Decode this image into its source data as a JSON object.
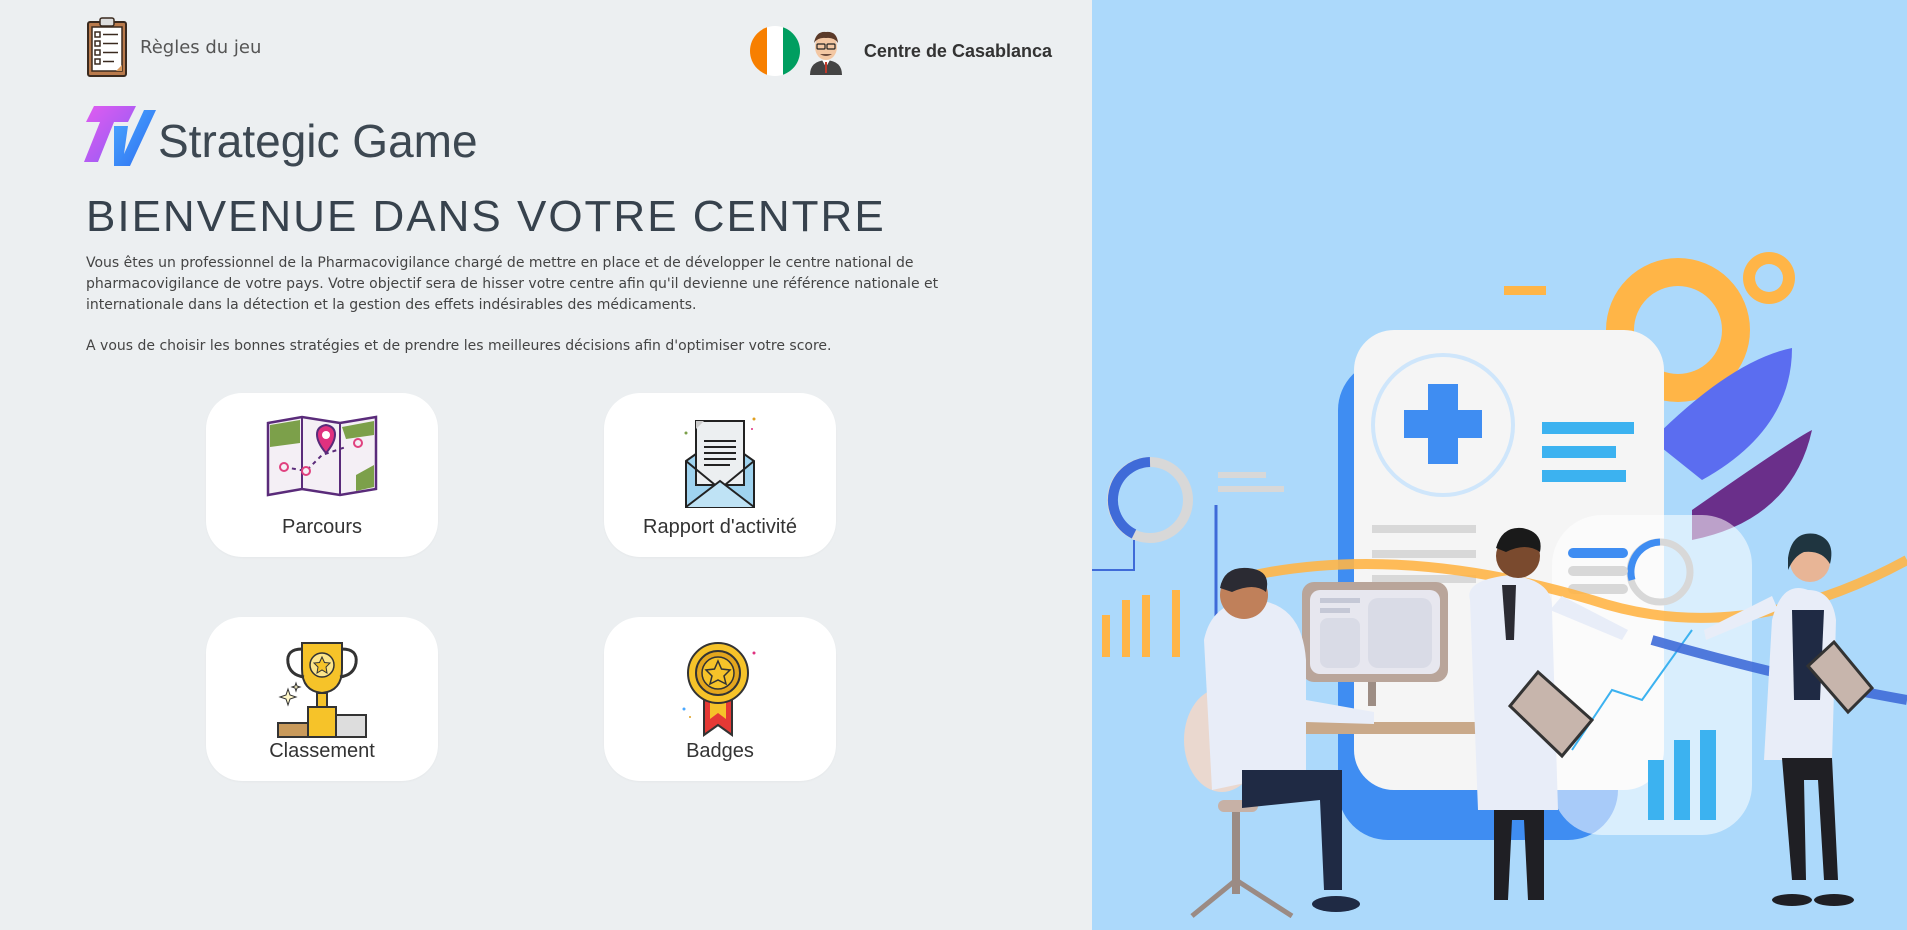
{
  "header": {
    "rules_label": "Règles du jeu",
    "center_name": "Centre de Casablanca"
  },
  "brand": {
    "name": "Strategic Game"
  },
  "main": {
    "title": "BIENVENUE DANS VOTRE CENTRE",
    "paragraph_1": "Vous êtes un professionnel de la Pharmacovigilance chargé de mettre en place et de développer le centre national de pharmacovigilance de votre pays. Votre objectif sera de hisser votre centre afin qu'il devienne une référence nationale et internationale dans la détection et la gestion des effets indésirables des médicaments.",
    "paragraph_2": "A vous de choisir les bonnes stratégies et de prendre les meilleures décisions afin d'optimiser votre score."
  },
  "cards": [
    {
      "label": "Parcours",
      "icon": "map-icon"
    },
    {
      "label": "Rapport d'activité",
      "icon": "mail-report-icon"
    },
    {
      "label": "Classement",
      "icon": "trophy-icon"
    },
    {
      "label": "Badges",
      "icon": "medal-badge-icon"
    }
  ],
  "colors": {
    "left_background": "#eceff1",
    "right_background": "#acd9fb",
    "card_background": "#ffffff",
    "brand_gradient_start": "#c85cf6",
    "brand_gradient_end": "#2e8cf5"
  }
}
